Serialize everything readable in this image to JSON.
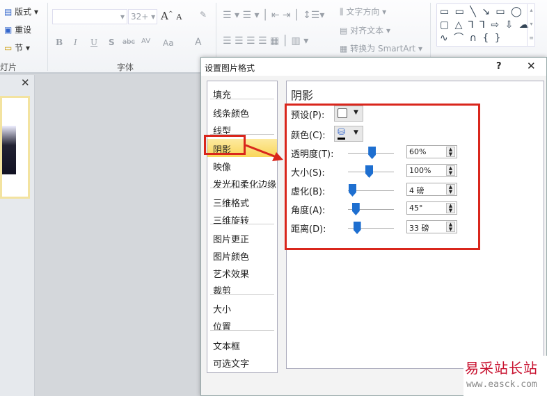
{
  "ribbon": {
    "slides_group": {
      "layout": "版式",
      "reset": "重设",
      "section": "节",
      "label": "灯片"
    },
    "font_group": {
      "font_size": "32+",
      "label": "字体",
      "bold": "B",
      "italic": "I",
      "underline": "U",
      "shadow": "S",
      "strike": "abc",
      "spacing": "AV",
      "case": "Aa",
      "color": "A"
    },
    "paragraph_group": {
      "text_direction": "文字方向",
      "align_text": "对齐文本",
      "convert_smartart": "转换为 SmartArt"
    },
    "shapes_glyphs": "▭ ▭ ╲ ↘ ▭ ◯ ▢ △ ⅂ ⅂ ⇨ ⇩ ☁ ∿ ⌒ ∩ { }"
  },
  "dialog": {
    "title": "设置图片格式",
    "help": "?",
    "close": "✕",
    "nav": [
      "填充",
      "线条颜色",
      "线型",
      "阴影",
      "映像",
      "发光和柔化边缘",
      "三维格式",
      "三维旋转",
      "图片更正",
      "图片颜色",
      "艺术效果",
      "裁剪",
      "大小",
      "位置",
      "文本框",
      "可选文字"
    ],
    "selected_nav": "阴影",
    "panel": {
      "heading": "阴影",
      "preset_label": "预设(P):",
      "color_label": "颜色(C):",
      "sliders": [
        {
          "label": "透明度(T):",
          "value": "60%",
          "level": 0.57
        },
        {
          "label": "大小(S):",
          "value": "100%",
          "level": 0.5
        },
        {
          "label": "虚化(B):",
          "value": "4 磅",
          "level": 0.1
        },
        {
          "label": "角度(A):",
          "value": "45°",
          "level": 0.18
        },
        {
          "label": "距离(D):",
          "value": "33 磅",
          "level": 0.21
        }
      ]
    }
  },
  "watermark": {
    "cn": "易采站长站",
    "url": "www.easck.com"
  },
  "colors": {
    "highlight": "#d9261c",
    "accent": "#1e6fd0",
    "selected_bg": "#fbe28a"
  }
}
